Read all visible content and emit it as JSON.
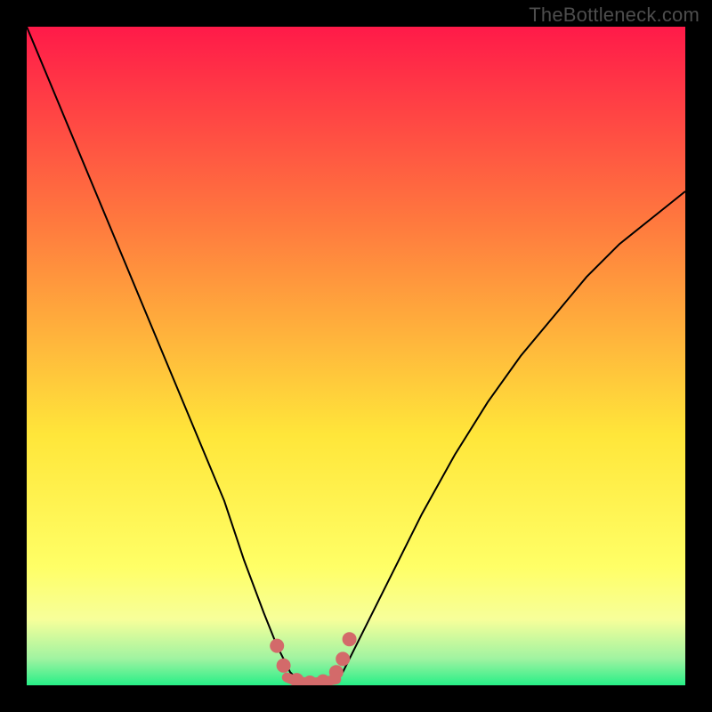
{
  "watermark": "TheBottleneck.com",
  "chart_data": {
    "type": "line",
    "title": "",
    "xlabel": "",
    "ylabel": "",
    "xlim": [
      0,
      100
    ],
    "ylim": [
      0,
      100
    ],
    "grid": false,
    "background_gradient": {
      "top": "#ff1a49",
      "mid_upper": "#ff7a3e",
      "mid": "#ffe63a",
      "lower_band": "#f7ff9a",
      "bottom": "#27ef87"
    },
    "series": [
      {
        "name": "bottleneck-curve",
        "stroke": "#000000",
        "x": [
          0,
          5,
          10,
          15,
          20,
          25,
          30,
          33,
          36,
          38,
          40,
          42,
          44,
          46,
          48,
          50,
          55,
          60,
          65,
          70,
          75,
          80,
          85,
          90,
          95,
          100
        ],
        "values": [
          100,
          88,
          76,
          64,
          52,
          40,
          28,
          19,
          11,
          6,
          2,
          0,
          0,
          0,
          2,
          6,
          16,
          26,
          35,
          43,
          50,
          56,
          62,
          67,
          71,
          75
        ]
      }
    ],
    "vertex_markers": {
      "color": "#d36a6a",
      "points": [
        {
          "x": 38,
          "y": 6
        },
        {
          "x": 39,
          "y": 3
        },
        {
          "x": 41,
          "y": 0.8
        },
        {
          "x": 43,
          "y": 0.4
        },
        {
          "x": 45,
          "y": 0.6
        },
        {
          "x": 47,
          "y": 2
        },
        {
          "x": 48,
          "y": 4
        },
        {
          "x": 49,
          "y": 7
        }
      ],
      "connector": [
        {
          "x": 39.5,
          "y": 1.2
        },
        {
          "x": 41,
          "y": 0.6
        },
        {
          "x": 43,
          "y": 0.4
        },
        {
          "x": 45,
          "y": 0.5
        },
        {
          "x": 47,
          "y": 0.9
        }
      ]
    }
  }
}
